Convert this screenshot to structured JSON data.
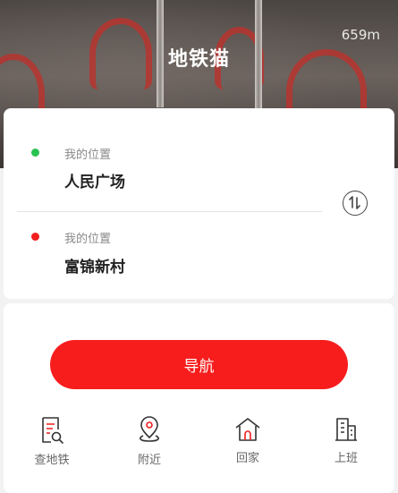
{
  "header": {
    "title": "地铁猫",
    "distance": "659m"
  },
  "route": {
    "origin": {
      "label": "我的位置",
      "name": "人民广场",
      "dot_color": "#28c350"
    },
    "destination": {
      "label": "我的位置",
      "name": "富锦新村",
      "dot_color": "#f21d1d"
    },
    "swap_icon": "swap-vertical-icon"
  },
  "actions": {
    "navigate_label": "导航",
    "accent": "#f71d1d",
    "tools": [
      {
        "label": "查地铁",
        "icon": "search-document-icon"
      },
      {
        "label": "附近",
        "icon": "location-pin-icon"
      },
      {
        "label": "回家",
        "icon": "home-icon"
      },
      {
        "label": "上班",
        "icon": "office-building-icon"
      }
    ]
  }
}
